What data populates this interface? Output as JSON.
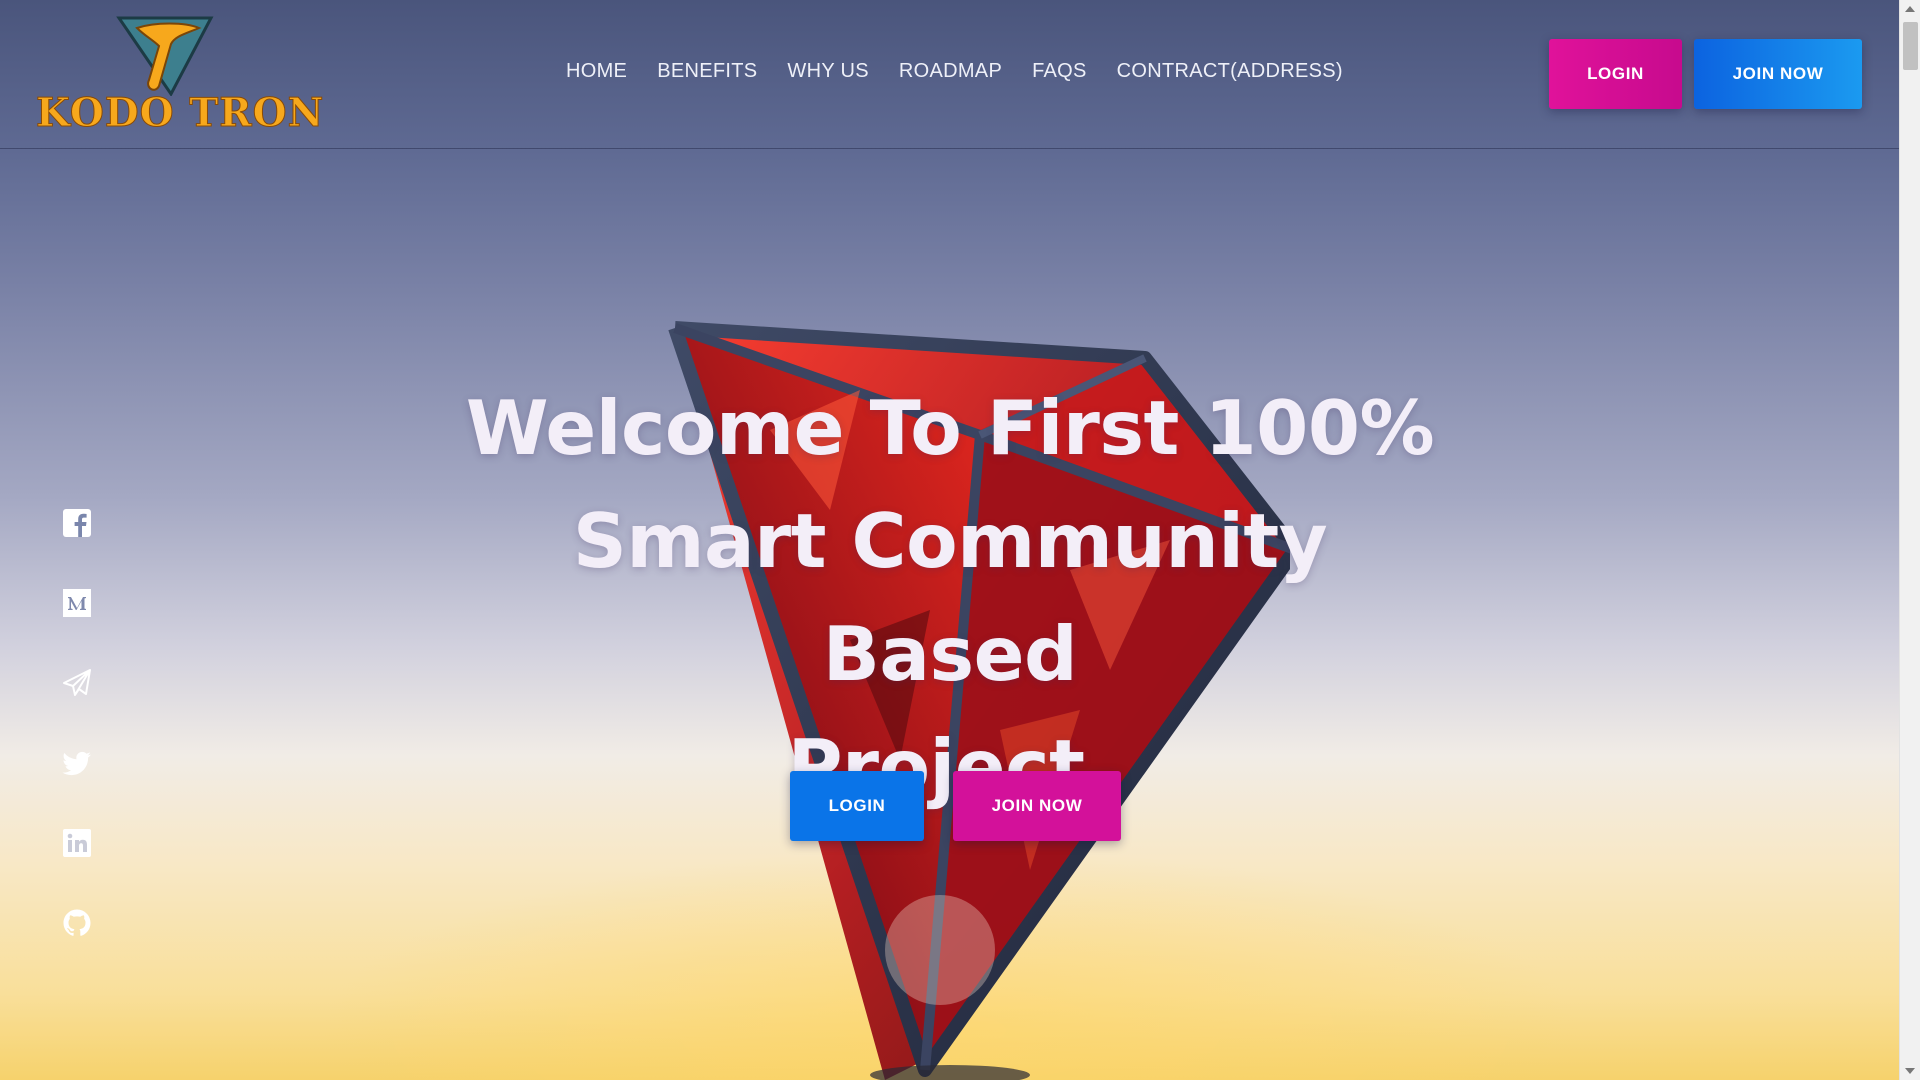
{
  "brand": {
    "logo_text": "KODO TRON",
    "logo_colors": {
      "text": "#f7a81c",
      "emblem": "#3a7a8a"
    }
  },
  "nav": {
    "items": [
      {
        "label": "HOME"
      },
      {
        "label": "BENEFITS"
      },
      {
        "label": "WHY US"
      },
      {
        "label": "ROADMAP"
      },
      {
        "label": "FAQS"
      },
      {
        "label": "CONTRACT(ADDRESS)"
      }
    ]
  },
  "header_buttons": {
    "login": "LOGIN",
    "join": "JOIN NOW"
  },
  "hero": {
    "title_line1": "Welcome To First 100%",
    "title_line2": "Smart Community Based",
    "title_line3": "Project.",
    "login": "LOGIN",
    "join": "JOIN NOW"
  },
  "social": [
    {
      "icon": "facebook-icon"
    },
    {
      "icon": "medium-icon"
    },
    {
      "icon": "telegram-icon"
    },
    {
      "icon": "twitter-icon"
    },
    {
      "icon": "linkedin-icon"
    },
    {
      "icon": "github-icon"
    }
  ],
  "colors": {
    "accent_pink": "#d3119a",
    "accent_blue": "#0a74e8",
    "header_bg": "#4a557c"
  }
}
